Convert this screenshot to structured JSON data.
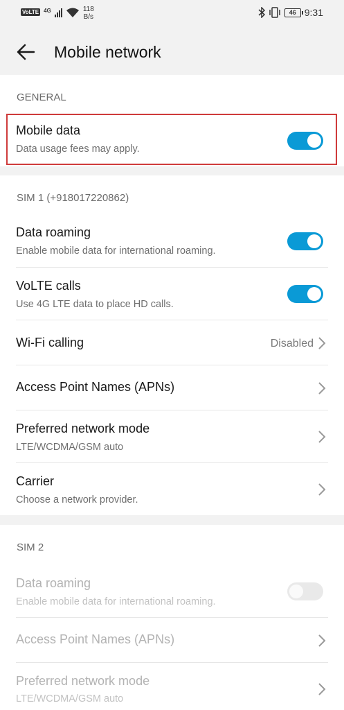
{
  "status_bar": {
    "volte": "VoLTE",
    "network_gen": "4G",
    "speed_value": "118",
    "speed_unit": "B/s",
    "battery": "46",
    "time": "9:31"
  },
  "header": {
    "back_icon": "arrow-left-icon",
    "title": "Mobile network"
  },
  "general": {
    "header": "GENERAL",
    "mobile_data": {
      "title": "Mobile data",
      "subtitle": "Data usage fees may apply.",
      "enabled": true
    }
  },
  "sim1": {
    "header": "SIM 1 (+918017220862)",
    "data_roaming": {
      "title": "Data roaming",
      "subtitle": "Enable mobile data for international roaming.",
      "enabled": true
    },
    "volte_calls": {
      "title": "VoLTE calls",
      "subtitle": "Use 4G LTE data to place HD calls.",
      "enabled": true
    },
    "wifi_calling": {
      "title": "Wi-Fi calling",
      "value": "Disabled"
    },
    "apn": {
      "title": "Access Point Names (APNs)"
    },
    "network_mode": {
      "title": "Preferred network mode",
      "subtitle": "LTE/WCDMA/GSM auto"
    },
    "carrier": {
      "title": "Carrier",
      "subtitle": "Choose a network provider."
    }
  },
  "sim2": {
    "header": "SIM 2",
    "data_roaming": {
      "title": "Data roaming",
      "subtitle": "Enable mobile data for international roaming.",
      "enabled": false
    },
    "apn": {
      "title": "Access Point Names (APNs)"
    },
    "network_mode": {
      "title": "Preferred network mode",
      "subtitle": "LTE/WCDMA/GSM auto"
    }
  },
  "colors": {
    "accent": "#0a9ad6",
    "highlight": "#cf3b3b"
  }
}
